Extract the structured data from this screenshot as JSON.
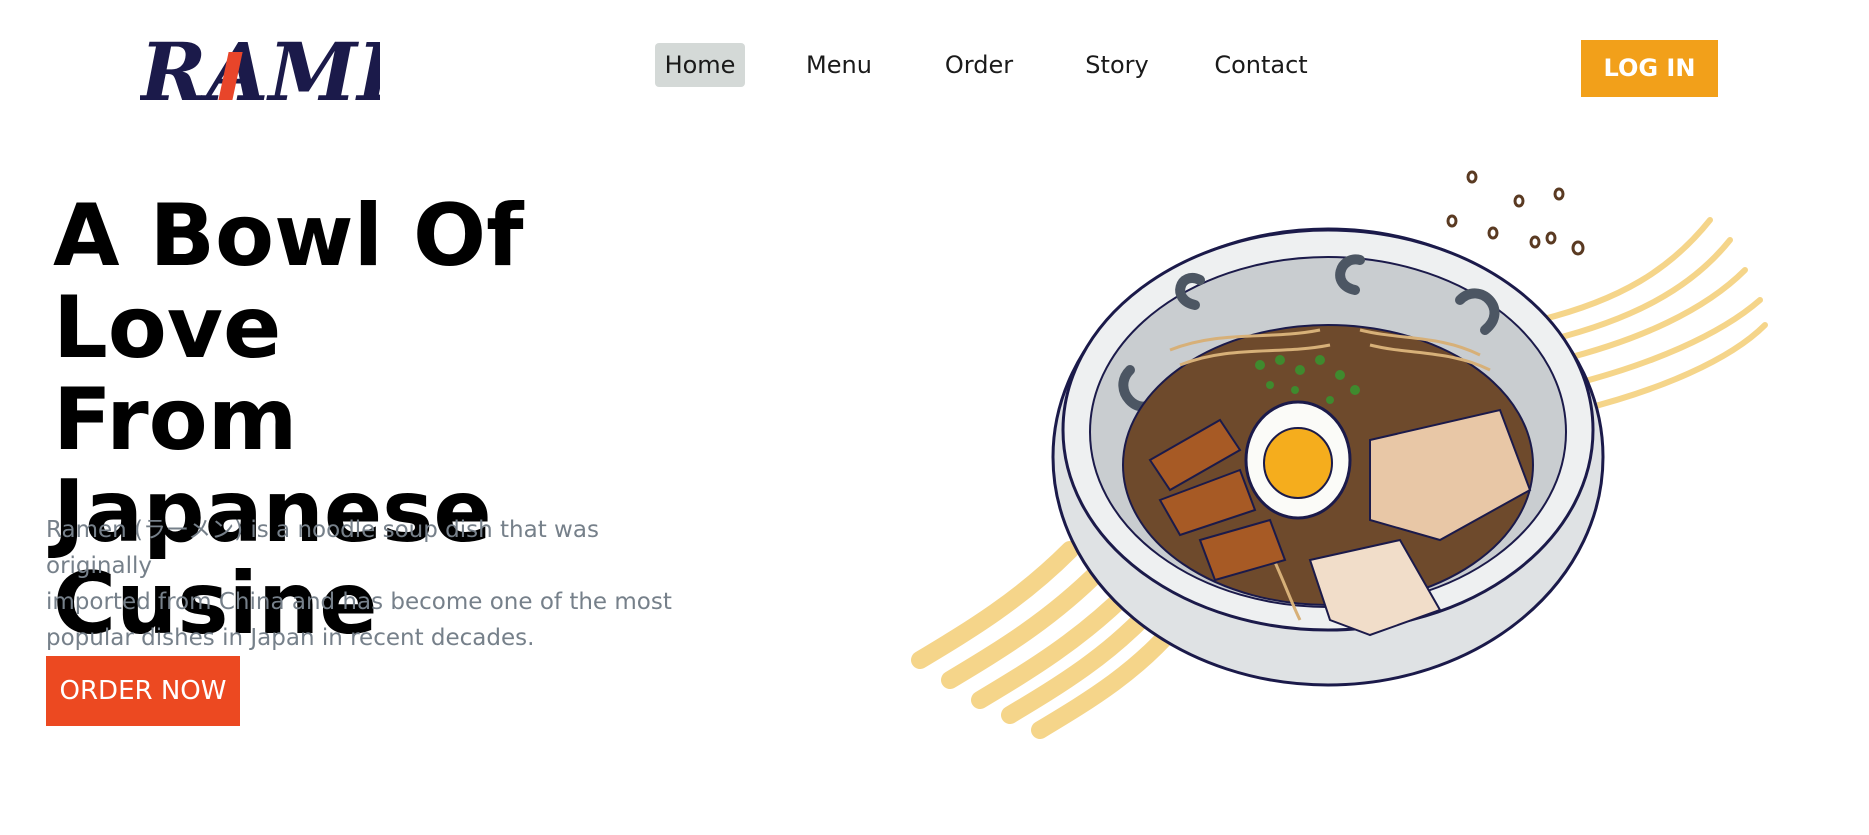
{
  "brand": {
    "logo_text": "RAMEN",
    "colors": {
      "primary": "#1b1a4a",
      "accent": "#e8452a"
    }
  },
  "nav": {
    "items": [
      {
        "label": "Home",
        "active": true
      },
      {
        "label": "Menu",
        "active": false
      },
      {
        "label": "Order",
        "active": false
      },
      {
        "label": "Story",
        "active": false
      },
      {
        "label": "Contact",
        "active": false
      }
    ],
    "login_label": "LOG IN"
  },
  "hero": {
    "title_lines": [
      "A Bowl Of Love",
      "From Japanese",
      "Cusine"
    ],
    "description_lines": [
      "Ramen (ラーメン) is a noodle soup dish that was originally",
      "imported from China and has become one of the most",
      "popular dishes in Japan in recent decades."
    ],
    "cta_label": "ORDER NOW",
    "illustration": "ramen-bowl-illustration"
  },
  "colors": {
    "login_button": "#f2a01a",
    "order_button": "#ec4921",
    "nav_active_bg": "#d4d9d7",
    "description_text": "#76808a",
    "noodle_stroke": "#f5d58a"
  }
}
